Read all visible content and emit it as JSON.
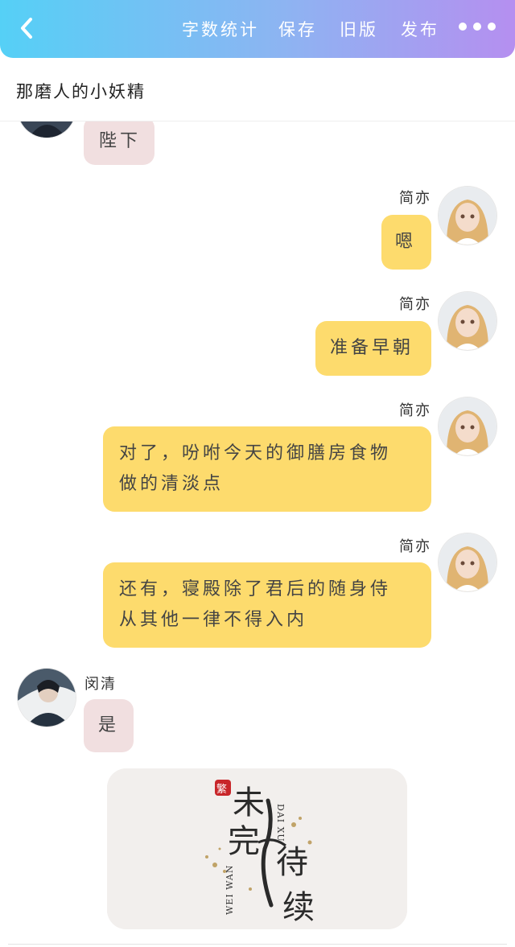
{
  "toolbar": {
    "word_count": "字数统计",
    "save": "保存",
    "old_version": "旧版",
    "publish": "发布",
    "more_icon": "more-dots-icon",
    "back_icon": "chevron-left-icon"
  },
  "story": {
    "title": "那磨人的小妖精"
  },
  "messages": [
    {
      "speaker": "",
      "side": "left",
      "text": "陛下"
    },
    {
      "speaker": "简亦",
      "side": "right",
      "text": "嗯"
    },
    {
      "speaker": "简亦",
      "side": "right",
      "text": "准备早朝"
    },
    {
      "speaker": "简亦",
      "side": "right",
      "lines": [
        "对了，吩咐今天的御膳房食物",
        "做的清淡点"
      ]
    },
    {
      "speaker": "简亦",
      "side": "right",
      "lines": [
        "还有，寝殿除了君后的随身侍",
        "从其他一律不得入内"
      ]
    },
    {
      "speaker": "闵清",
      "side": "left",
      "text": "是"
    }
  ],
  "end_card": {
    "seal": "繁",
    "main_1": "未",
    "main_2": "完",
    "main_3": "待",
    "main_4": "续",
    "latin_1": "DAI XU",
    "latin_2": "WEI WAN"
  },
  "colors": {
    "header_gradient_start": "#55d0f6",
    "header_gradient_end": "#b58ff0",
    "bubble_right": "#fddb6d",
    "bubble_left": "#f1dfe0"
  }
}
